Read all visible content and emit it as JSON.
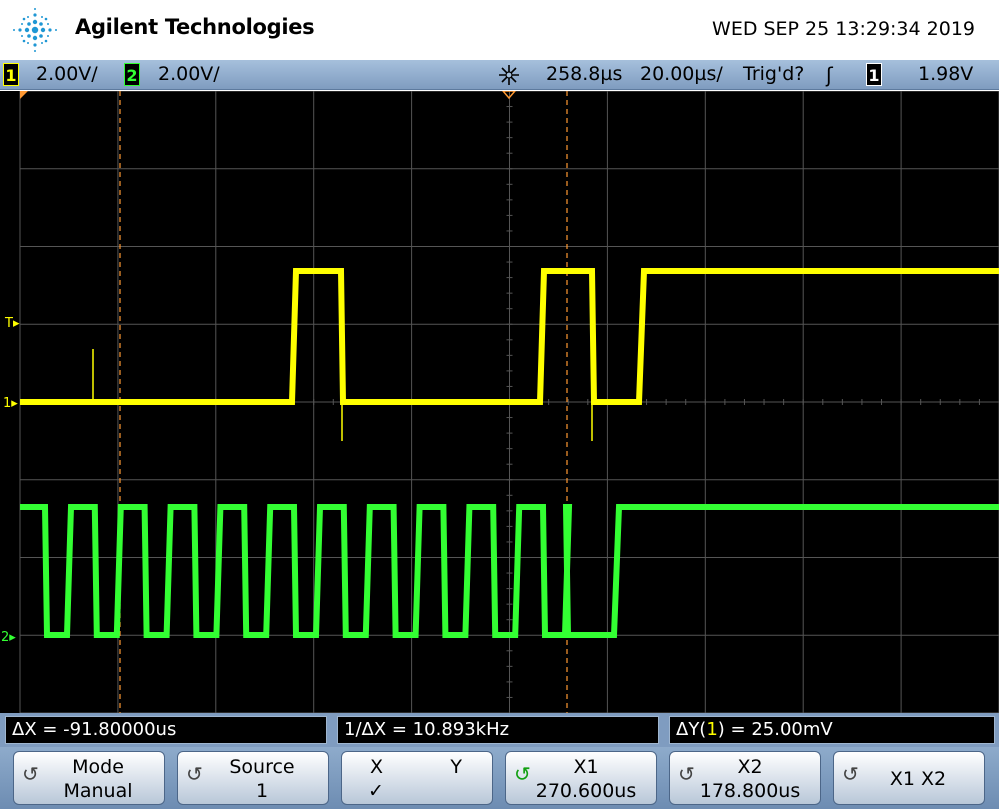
{
  "header": {
    "brand": "Agilent Technologies",
    "datetime": "WED SEP 25 13:29:34 2019"
  },
  "status": {
    "ch1_num": "1",
    "ch1_scale": "2.00V/",
    "ch2_num": "2",
    "ch2_scale": "2.00V/",
    "delay": "258.8µs",
    "timebase": "20.00µs/",
    "trigger_state": "Trig'd?",
    "trigger_edge_icon": "rising-edge-icon",
    "trigger_source": "1",
    "trigger_level": "1.98V"
  },
  "screen": {
    "ch1_marker": "1",
    "ch2_marker": "2",
    "trigger_marker": "T",
    "colors": {
      "ch1": "#ffff00",
      "ch2": "#33ff33",
      "cursor": "#ff9933",
      "grid": "#555555",
      "background": "#000000"
    }
  },
  "measurements": {
    "delta_x": "ΔX = -91.80000us",
    "inv_delta_x": "1/ΔX = 10.893kHz",
    "delta_y_prefix": "ΔY(",
    "delta_y_channel": "1",
    "delta_y_suffix": ") = 25.00mV"
  },
  "softkeys": {
    "mode_label": "Mode",
    "mode_value": "Manual",
    "source_label": "Source",
    "source_value": "1",
    "x_label": "X",
    "y_label": "Y",
    "x_check": "✓",
    "x1_label": "X1",
    "x1_value": "270.600us",
    "x2_label": "X2",
    "x2_value": "178.800us",
    "x1x2_label": "X1 X2"
  }
}
